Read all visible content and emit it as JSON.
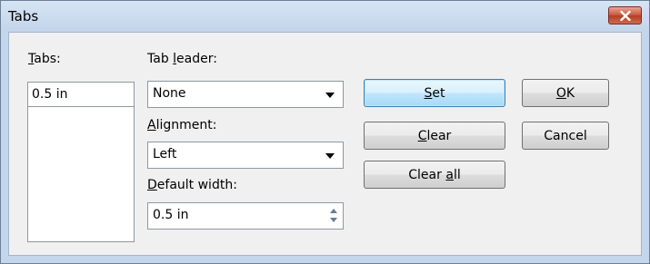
{
  "window": {
    "title": "Tabs",
    "close_label": "x"
  },
  "tabs": {
    "label_prefix": "",
    "label_mnemonic": "T",
    "label_rest": "abs:",
    "value": "0.5 in",
    "list_items": []
  },
  "tab_leader": {
    "label_prefix": "Tab ",
    "label_mnemonic": "l",
    "label_rest": "eader:",
    "selected": "None"
  },
  "alignment": {
    "label_prefix": "",
    "label_mnemonic": "A",
    "label_rest": "lignment:",
    "selected": "Left"
  },
  "default_width": {
    "label_prefix": "",
    "label_mnemonic": "D",
    "label_rest": "efault width:",
    "value": "0.5 in"
  },
  "buttons": {
    "set": {
      "mnemonic": "S",
      "rest": "et"
    },
    "clear": {
      "mnemonic": "C",
      "rest": "lear"
    },
    "clear_all": {
      "prefix": "Clear ",
      "mnemonic": "a",
      "rest": "ll"
    },
    "ok": {
      "mnemonic": "O",
      "rest": "K"
    },
    "cancel": "Cancel"
  }
}
